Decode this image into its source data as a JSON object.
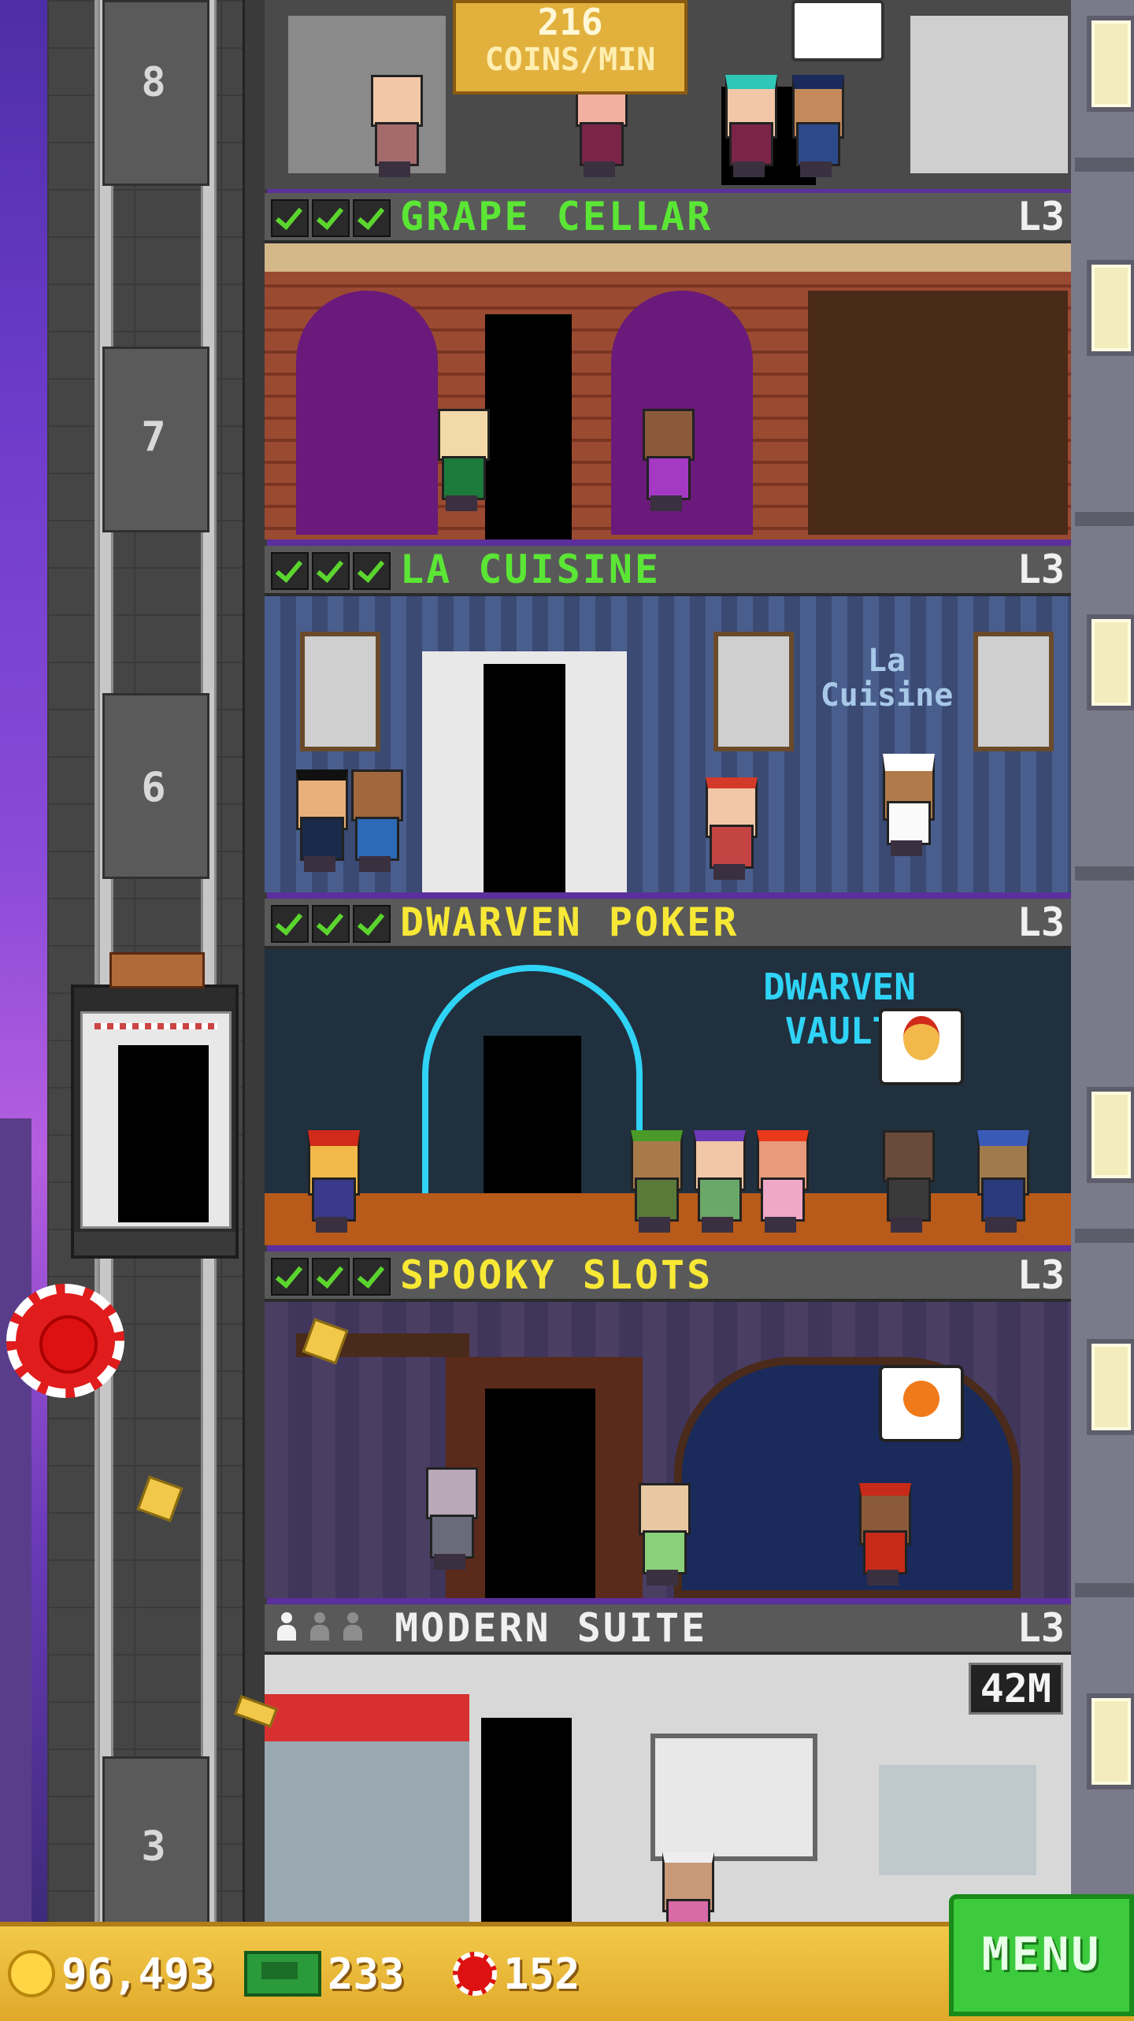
{
  "header": {
    "coins_per_min_value": "216",
    "coins_per_min_label": "COINS/MIN"
  },
  "elevator": {
    "floor_numbers": [
      "8",
      "7",
      "6",
      "3"
    ]
  },
  "floors": [
    {
      "name": "GRAPE CELLAR",
      "level": "L3",
      "name_color": "#5be635",
      "stocked_checks": 3
    },
    {
      "name": "LA CUISINE",
      "level": "L3",
      "name_color": "#5be635",
      "stocked_checks": 3,
      "sign": "La Cuisine"
    },
    {
      "name": "DWARVEN POKER",
      "level": "L3",
      "name_color": "#f7e836",
      "stocked_checks": 3,
      "sign": "DWARVEN VAULT"
    },
    {
      "name": "SPOOKY SLOTS",
      "level": "L3",
      "name_color": "#f7e836",
      "stocked_checks": 3
    },
    {
      "name": "MODERN SUITE",
      "level": "L3",
      "name_color": "#f0f0f0",
      "occupancy": "1/3",
      "price": "42M"
    }
  ],
  "bottom_bar": {
    "coins": "96,493",
    "bux": "233",
    "chips": "152",
    "menu_label": "MENU"
  },
  "icons": {
    "coin": "coin-icon",
    "bux": "bux-icon",
    "chip": "poker-chip-icon",
    "check": "check-icon"
  },
  "colors": {
    "menu_green": "#3dcb3d",
    "bar_gold": "#e8b63a",
    "check_green": "#5bd52e"
  }
}
